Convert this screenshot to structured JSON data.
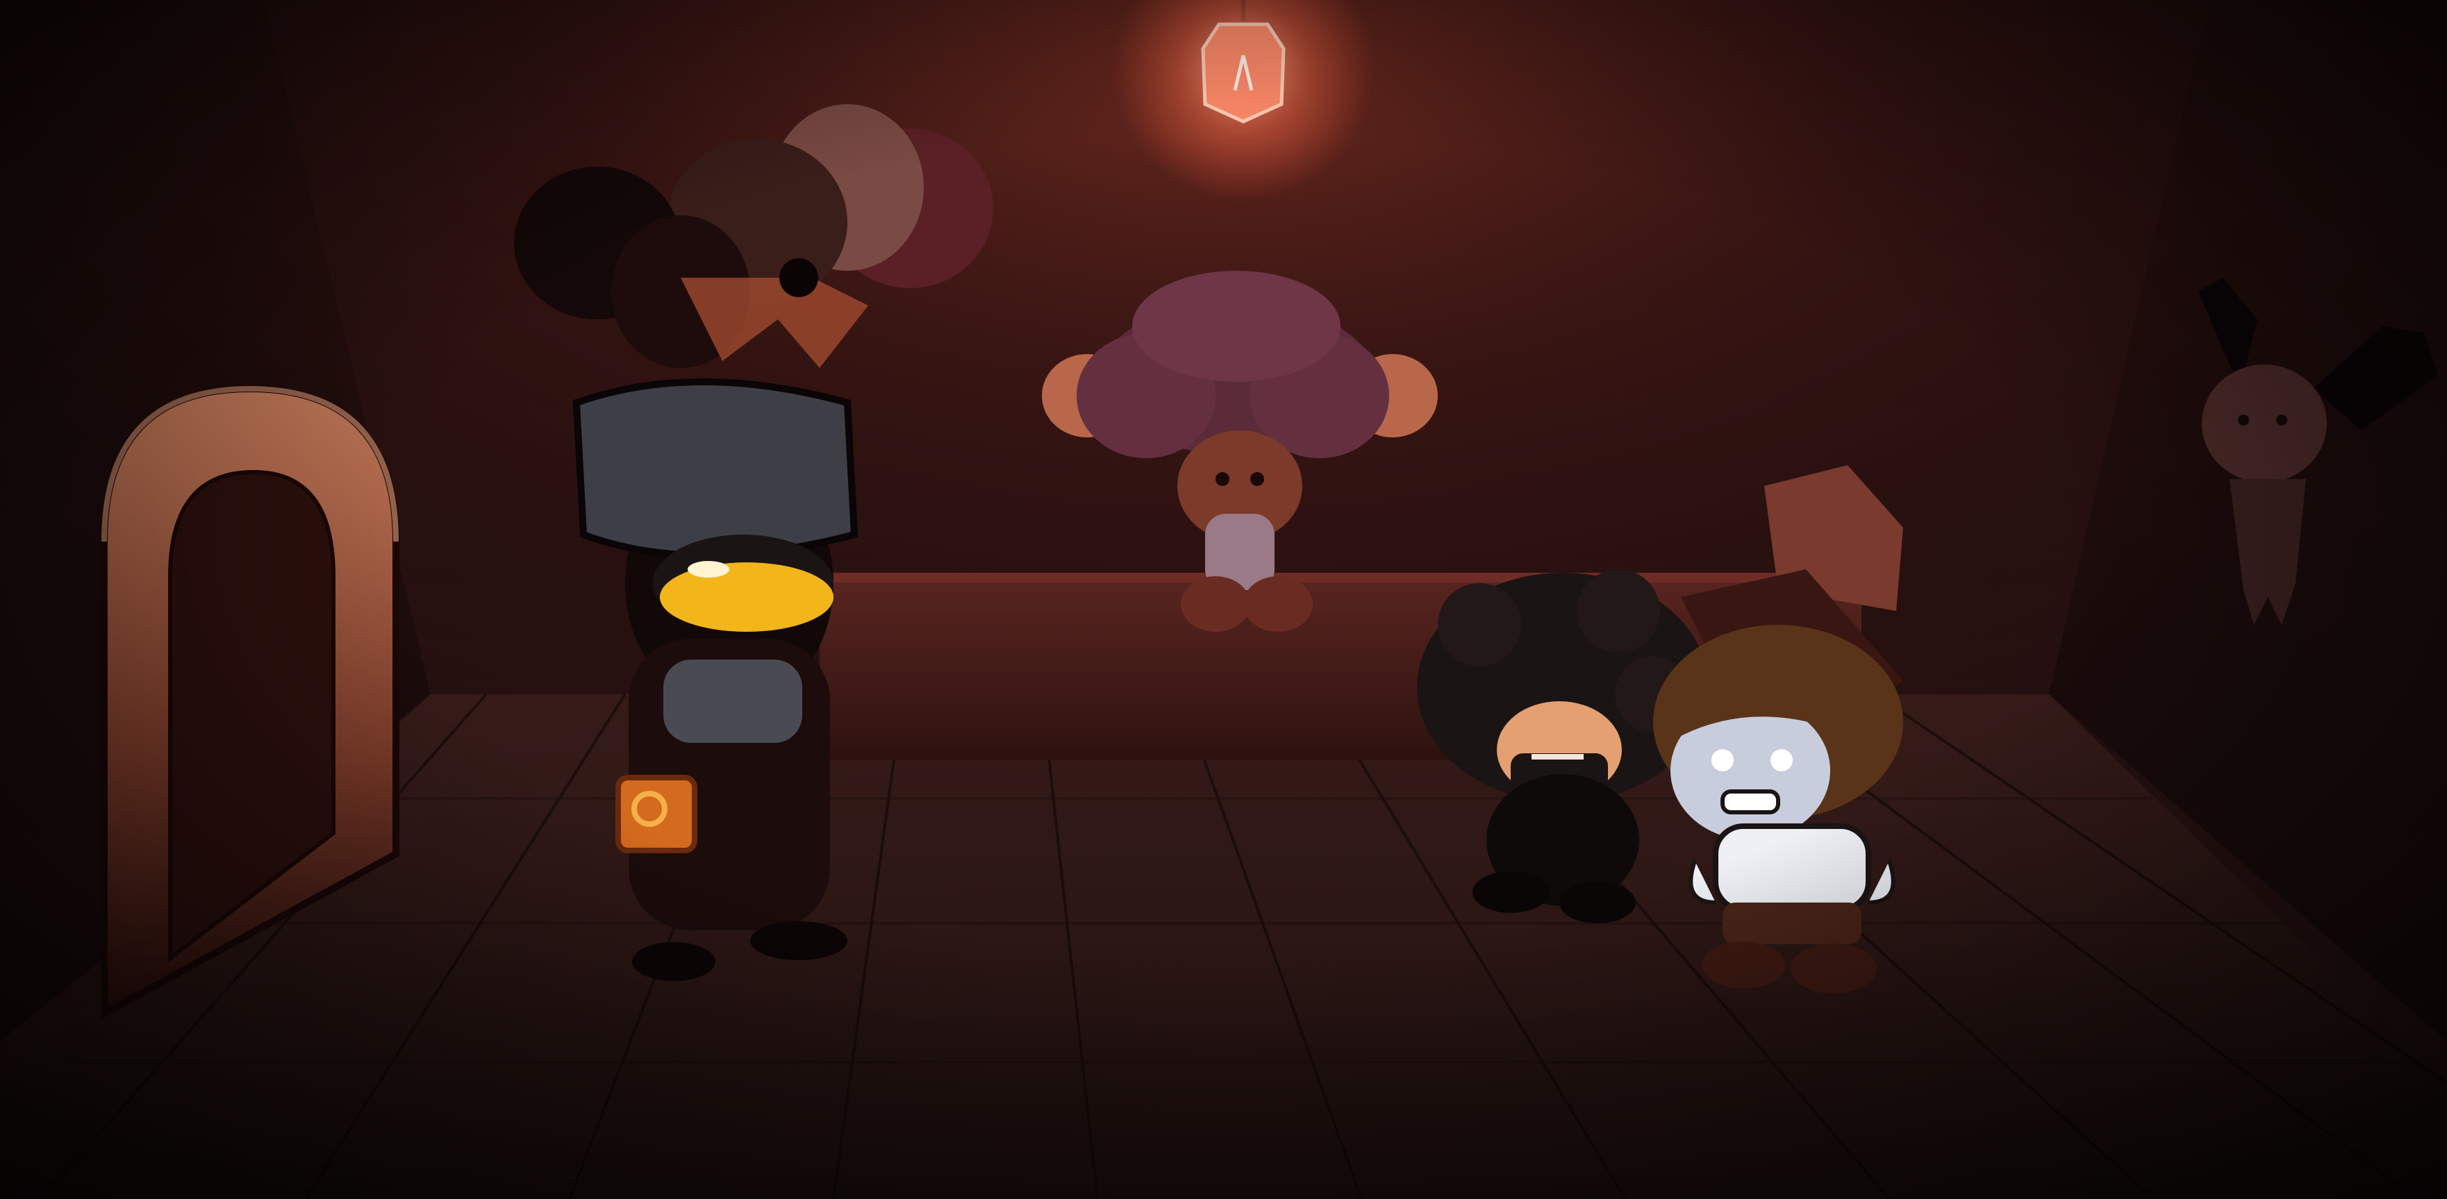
{
  "scene": {
    "colors": {
      "wall": "#2a1414",
      "floor": "#2c1816",
      "bench": "#4a1e1a",
      "lamp_glow": "#ff7a55",
      "door": "#b86a4a",
      "accent_yellow": "#f2b51a",
      "vignette": "#050203"
    },
    "objects": [
      "hanging-bulb-lamp",
      "arched-door",
      "wall-bench",
      "wall-trophy-heads",
      "hanging-ghost-doll",
      "wooden-plank-floor"
    ],
    "characters": [
      "hat-character",
      "seated-curly-girl",
      "dark-curly-boy",
      "white-shirt-boy"
    ]
  }
}
